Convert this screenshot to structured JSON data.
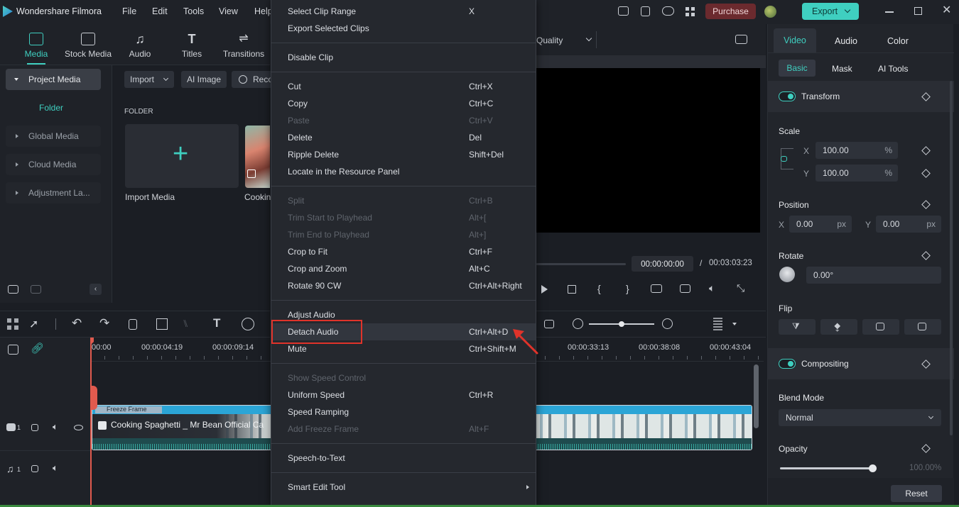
{
  "app": {
    "title": "Wondershare Filmora"
  },
  "menubar": [
    "File",
    "Edit",
    "Tools",
    "View",
    "Help"
  ],
  "titlebar": {
    "purchase": "Purchase",
    "export": "Export"
  },
  "media_tabs": [
    "Media",
    "Stock Media",
    "Audio",
    "Titles",
    "Transitions"
  ],
  "left_nav": {
    "active": "Project Media",
    "folder": "Folder",
    "items": [
      "Global Media",
      "Cloud Media",
      "Adjustment La..."
    ]
  },
  "media_toolbar": {
    "import": "Import",
    "ai_image": "AI Image",
    "record": "Reco"
  },
  "media": {
    "folder_heading": "FOLDER",
    "import_label": "Import Media",
    "clip_label": "Cookin"
  },
  "preview": {
    "quality": "Quality",
    "current_time": "00:00:00:00",
    "separator": "/",
    "total_time": "00:03:03:23"
  },
  "timeline": {
    "ruler": [
      "00:00",
      "00:00:04:19",
      "00:00:09:14",
      "00:00:33:13",
      "00:00:38:08",
      "00:00:43:04"
    ],
    "freeze_label": "Freeze Frame",
    "clip_title": "Cooking Spaghetti _ Mr Bean Official Ca",
    "track_video": "1",
    "track_audio": "1"
  },
  "context_menu": {
    "items": [
      {
        "label": "Select Clip Range",
        "shortcut": "X"
      },
      {
        "label": "Export Selected Clips",
        "shortcut": ""
      },
      {
        "label": "Disable Clip",
        "shortcut": ""
      },
      {
        "label": "Cut",
        "shortcut": "Ctrl+X"
      },
      {
        "label": "Copy",
        "shortcut": "Ctrl+C"
      },
      {
        "label": "Paste",
        "shortcut": "Ctrl+V"
      },
      {
        "label": "Delete",
        "shortcut": "Del"
      },
      {
        "label": "Ripple Delete",
        "shortcut": "Shift+Del"
      },
      {
        "label": "Locate in the Resource Panel",
        "shortcut": ""
      },
      {
        "label": "Split",
        "shortcut": "Ctrl+B"
      },
      {
        "label": "Trim Start to Playhead",
        "shortcut": "Alt+["
      },
      {
        "label": "Trim End to Playhead",
        "shortcut": "Alt+]"
      },
      {
        "label": "Crop to Fit",
        "shortcut": "Ctrl+F"
      },
      {
        "label": "Crop and Zoom",
        "shortcut": "Alt+C"
      },
      {
        "label": "Rotate 90 CW",
        "shortcut": "Ctrl+Alt+Right"
      },
      {
        "label": "Adjust Audio",
        "shortcut": ""
      },
      {
        "label": "Detach Audio",
        "shortcut": "Ctrl+Alt+D"
      },
      {
        "label": "Mute",
        "shortcut": "Ctrl+Shift+M"
      },
      {
        "label": "Show Speed Control",
        "shortcut": ""
      },
      {
        "label": "Uniform Speed",
        "shortcut": "Ctrl+R"
      },
      {
        "label": "Speed Ramping",
        "shortcut": ""
      },
      {
        "label": "Add Freeze Frame",
        "shortcut": "Alt+F"
      },
      {
        "label": "Speech-to-Text",
        "shortcut": ""
      },
      {
        "label": "Smart Edit Tool",
        "shortcut": ""
      }
    ]
  },
  "right_panel": {
    "tabs": [
      "Video",
      "Audio",
      "Color"
    ],
    "subtabs": [
      "Basic",
      "Mask",
      "AI Tools"
    ],
    "transform": "Transform",
    "scale": {
      "label": "Scale",
      "x_label": "X",
      "x": "100.00",
      "y_label": "Y",
      "y": "100.00",
      "unit": "%"
    },
    "position": {
      "label": "Position",
      "x_label": "X",
      "x": "0.00",
      "y_label": "Y",
      "y": "0.00",
      "unit": "px"
    },
    "rotate": {
      "label": "Rotate",
      "value": "0.00°"
    },
    "flip": "Flip",
    "compositing": "Compositing",
    "blend_mode": {
      "label": "Blend Mode",
      "value": "Normal"
    },
    "opacity": {
      "label": "Opacity",
      "value": "100.00",
      "unit": "%",
      "level": 1.0
    },
    "reset": "Reset"
  },
  "colors": {
    "accent": "#3fcfc0",
    "highlight": "#e0332a",
    "purchase": "#6b2a2e"
  }
}
